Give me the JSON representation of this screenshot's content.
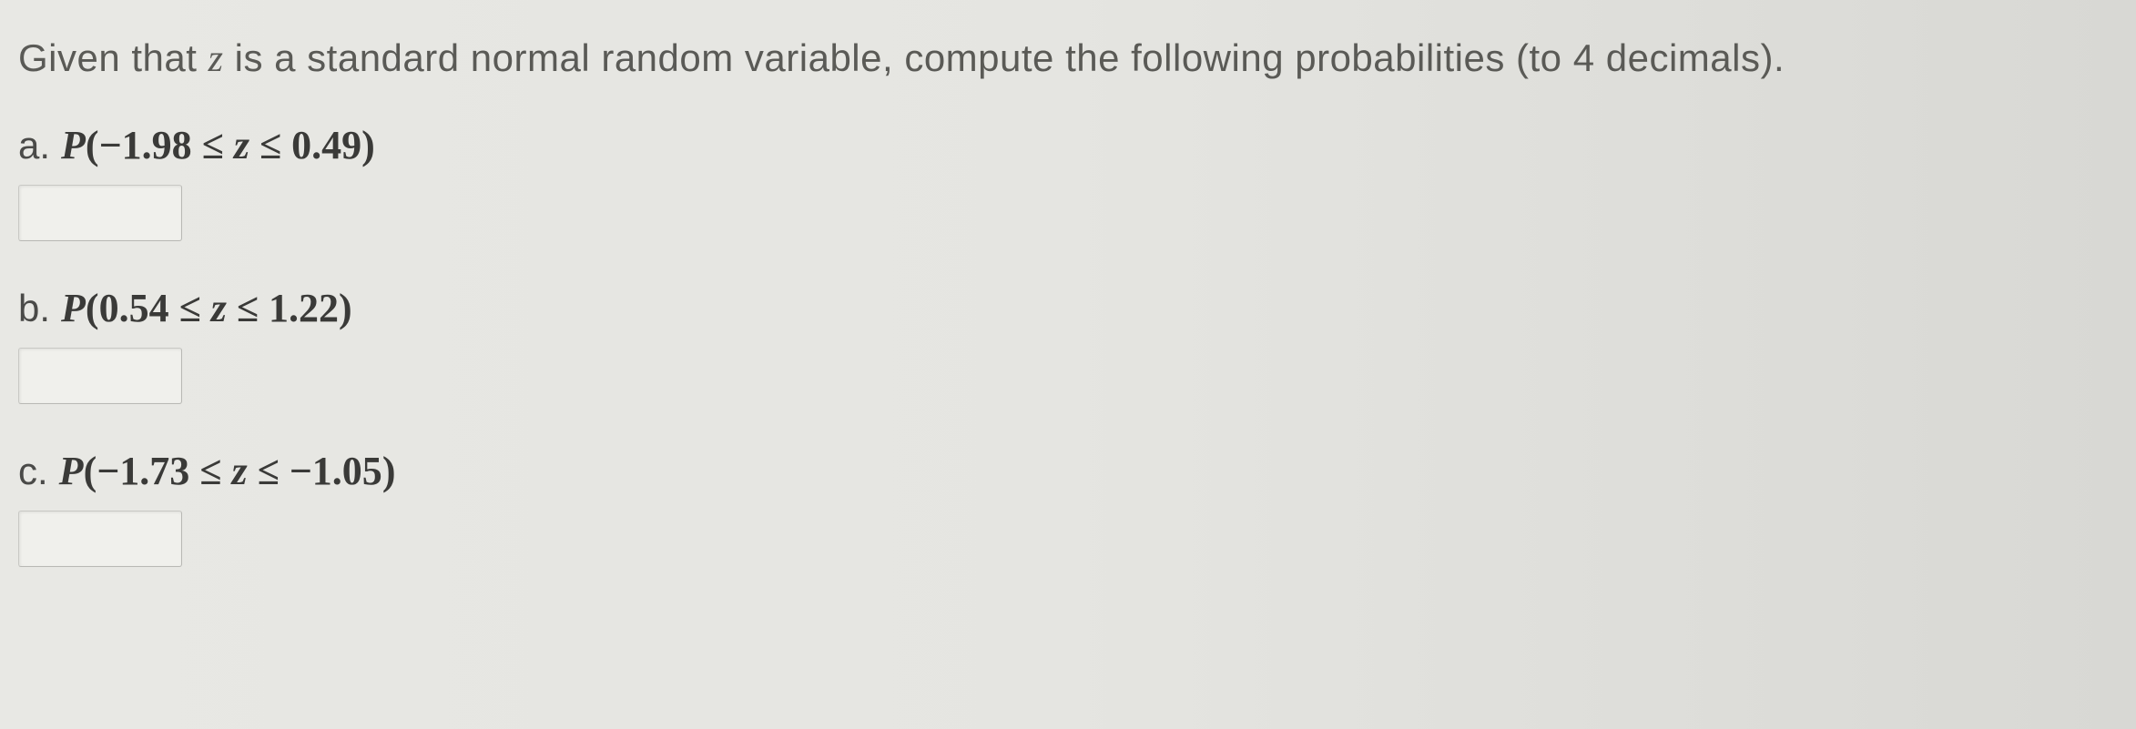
{
  "intro": {
    "before_z": "Given that ",
    "z": "z",
    "after_z": " is a standard normal random variable, compute the following probabilities (to 4 decimals)."
  },
  "parts": {
    "a": {
      "prefix": "a.",
      "P": "P",
      "open": "(",
      "lower": "−1.98",
      "le1": " ≤ ",
      "z": "z",
      "le2": " ≤ ",
      "upper": "0.49",
      "close": ")",
      "answer": ""
    },
    "b": {
      "prefix": "b.",
      "P": "P",
      "open": "(",
      "lower": "0.54",
      "le1": " ≤ ",
      "z": "z",
      "le2": " ≤ ",
      "upper": "1.22",
      "close": ")",
      "answer": ""
    },
    "c": {
      "prefix": "c.",
      "P": "P",
      "open": "(",
      "lower": "−1.73",
      "le1": " ≤ ",
      "z": "z",
      "le2": " ≤ ",
      "upper": "−1.05",
      "close": ")",
      "answer": ""
    }
  }
}
